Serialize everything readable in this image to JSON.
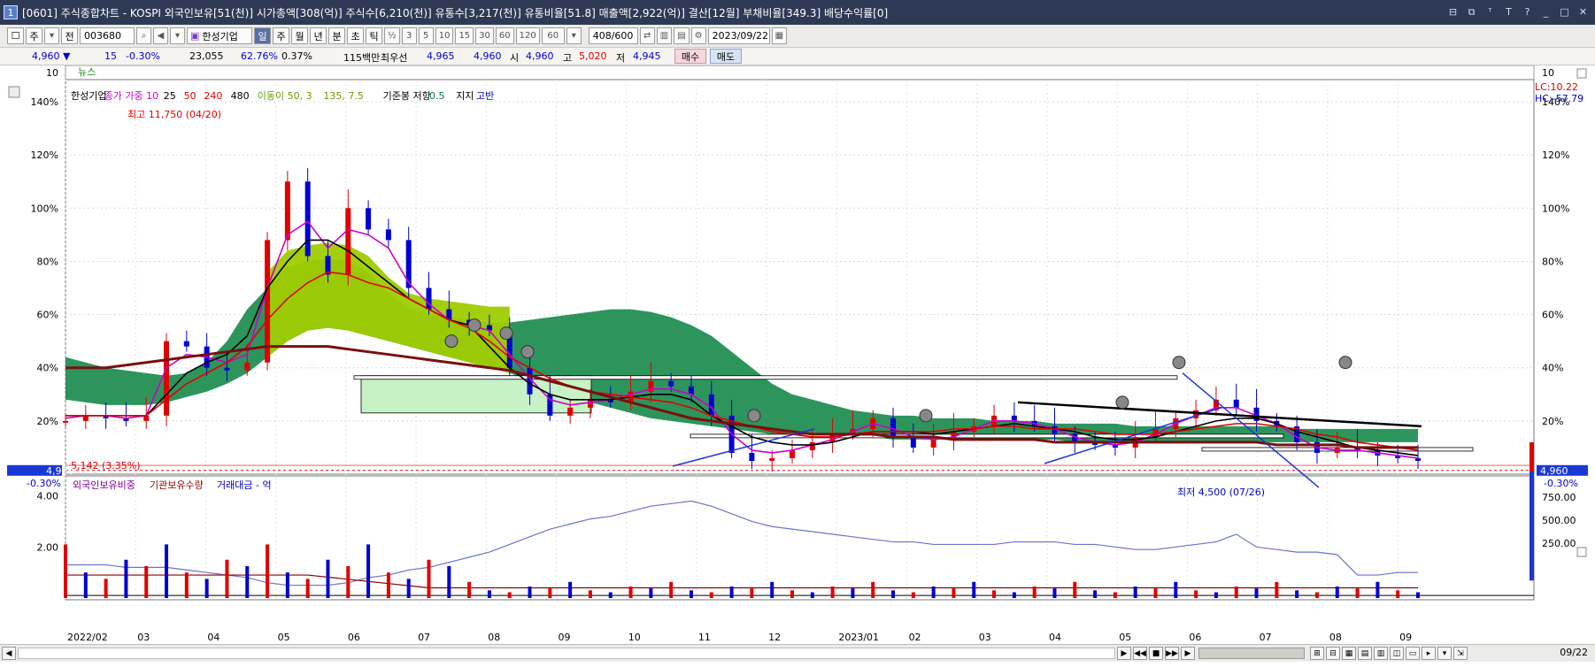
{
  "titlebar": {
    "num": "1",
    "text": "[0601] 주식종합차트 - KOSPI 외국인보유[51(천)] 시가총액[308(억)] 주식수[6,210(천)] 유통수[3,217(천)] 유통비율[51.8] 매출액[2,922(억)] 결산[12월] 부채비율[349.3] 배당수익률[0]",
    "icons": [
      "restore-icon",
      "window-icon",
      "font-icon",
      "text-icon",
      "help-icon",
      "minimize-icon",
      "maximize-icon",
      "close-icon"
    ],
    "icon_glyphs": [
      "⊟",
      "⧉",
      "ᵀ",
      "T",
      "?",
      "_",
      "□",
      "✕"
    ]
  },
  "toolbar": {
    "market": "주",
    "mode": "전",
    "code": "003680",
    "name": "한성기업",
    "periods": [
      "일",
      "주",
      "월",
      "년",
      "분",
      "초",
      "틱"
    ],
    "active_period": "일",
    "ticks": [
      "½",
      "3",
      "5",
      "10",
      "15",
      "30",
      "60",
      "120",
      "60"
    ],
    "count": "408/600",
    "date": "2023/09/22"
  },
  "quote": {
    "price": "4,960",
    "arrow": "▼",
    "change": "15",
    "change_pct": "-0.30%",
    "volume": "23,055",
    "vol_ratio": "62.76%",
    "turnover": "0.37%",
    "amount": "115백만",
    "best_ask_label": "최우선",
    "best_ask": "4,965",
    "best_bid": "4,960",
    "open_label": "시",
    "open": "4,960",
    "high_label": "고",
    "high": "5,020",
    "low_label": "저",
    "low": "4,945",
    "buy": "매수",
    "sell": "매도"
  },
  "chart_data": [
    {
      "type": "line",
      "title": "",
      "legend": [
        "한성기업",
        "종가 가중 10",
        "25",
        "50",
        "240",
        "480",
        "이동이 50, 3",
        "135, 7.5",
        "기준봉 저항",
        "0.5",
        "지지",
        "고반"
      ],
      "legend_colors": [
        "#000",
        "#cc00cc",
        "#000",
        "#e00000",
        "#e00000",
        "#000",
        "#6a9c00",
        "#6a9c00",
        "#000",
        "#007a3d",
        "#000",
        "#0000d0"
      ],
      "ylabel": "%",
      "y_ticks": [
        "140%",
        "120%",
        "100%",
        "80%",
        "60%",
        "40%",
        "20%"
      ],
      "ylim": [
        0,
        145
      ],
      "x_ticks": [
        "2022/02",
        "03",
        "04",
        "05",
        "06",
        "07",
        "08",
        "09",
        "10",
        "11",
        "12",
        "2023/01",
        "02",
        "03",
        "04",
        "05",
        "06",
        "07",
        "08",
        "09"
      ],
      "x_end_label": "09/22",
      "series": [
        {
          "values": [
            20,
            22,
            21,
            20,
            22,
            50,
            48,
            40,
            39,
            42,
            88,
            110,
            82,
            75,
            100,
            92,
            88,
            70,
            62,
            58,
            56,
            54,
            40,
            30,
            22,
            25,
            28,
            27,
            31,
            35,
            33,
            30,
            22,
            8,
            5,
            6,
            9,
            12,
            15,
            17,
            21,
            14,
            10,
            13,
            16,
            18,
            22,
            20,
            18,
            15,
            12,
            11,
            10,
            14,
            17,
            21,
            24,
            28,
            25,
            20,
            18,
            12,
            8,
            10,
            9,
            7,
            6,
            5
          ]
        },
        {
          "name": "10",
          "values": [
            21,
            22,
            22,
            21,
            22,
            40,
            45,
            44,
            42,
            45,
            70,
            90,
            95,
            85,
            92,
            90,
            85,
            72,
            64,
            58,
            56,
            54,
            45,
            36,
            28,
            26,
            27,
            28,
            30,
            32,
            32,
            30,
            25,
            15,
            9,
            8,
            9,
            11,
            13,
            16,
            19,
            17,
            14,
            13,
            14,
            17,
            20,
            20,
            19,
            17,
            14,
            12,
            11,
            12,
            15,
            19,
            22,
            25,
            25,
            22,
            19,
            14,
            10,
            9,
            9,
            8,
            7,
            6
          ]
        },
        {
          "name": "25",
          "values": [
            22,
            22,
            22,
            22,
            22,
            30,
            38,
            42,
            45,
            52,
            70,
            80,
            88,
            88,
            84,
            78,
            72,
            66,
            62,
            58,
            56,
            48,
            40,
            34,
            30,
            28,
            28,
            28,
            29,
            30,
            30,
            28,
            22,
            18,
            14,
            12,
            11,
            11,
            12,
            14,
            16,
            16,
            16,
            15,
            16,
            17,
            18,
            19,
            18,
            17,
            16,
            14,
            13,
            13,
            14,
            16,
            18,
            20,
            21,
            21,
            19,
            16,
            14,
            12,
            10,
            9,
            8,
            7
          ]
        },
        {
          "name": "50",
          "values": [
            22,
            22,
            22,
            22,
            22,
            28,
            34,
            38,
            42,
            48,
            58,
            66,
            72,
            76,
            75,
            72,
            70,
            66,
            62,
            58,
            55,
            50,
            44,
            40,
            36,
            33,
            31,
            30,
            29,
            28,
            27,
            25,
            22,
            20,
            18,
            16,
            15,
            14,
            14,
            15,
            16,
            16,
            16,
            16,
            17,
            17,
            18,
            18,
            17,
            17,
            17,
            16,
            15,
            15,
            15,
            16,
            17,
            18,
            19,
            19,
            18,
            17,
            15,
            14,
            12,
            11,
            10,
            9
          ]
        },
        {
          "name": "240",
          "values": [
            40,
            40,
            40,
            41,
            42,
            43,
            44,
            45,
            46,
            47,
            48,
            48,
            48,
            48,
            47,
            46,
            45,
            44,
            43,
            42,
            41,
            40,
            39,
            37,
            35,
            33,
            31,
            29,
            27,
            25,
            23,
            21,
            20,
            19,
            18,
            17,
            16,
            15,
            15,
            15,
            15,
            14,
            14,
            14,
            13,
            13,
            13,
            13,
            13,
            12,
            12,
            12,
            12,
            12,
            12,
            12,
            12,
            12,
            12,
            12,
            11,
            11,
            11,
            11,
            10,
            10,
            10,
            10
          ]
        }
      ]
    },
    {
      "type": "line",
      "title": "",
      "legend": [
        "외국인보유비중",
        "기관보유수량",
        "거래대금 - 억"
      ],
      "legend_colors": [
        "#7a00a0",
        "#8b0000",
        "#0000cc"
      ],
      "left_ticks": [
        "4.00",
        "2.00"
      ],
      "right_ticks": [
        "750.00",
        "500.00",
        "250.00"
      ],
      "series": [
        {
          "name": "외국인보유비중",
          "values": [
            1.3,
            1.3,
            1.3,
            1.2,
            1.2,
            1.2,
            1.1,
            1.0,
            0.9,
            0.8,
            0.6,
            0.5,
            0.5,
            0.5,
            0.6,
            0.8,
            0.9,
            1.1,
            1.2,
            1.4,
            1.6,
            1.8,
            2.1,
            2.4,
            2.7,
            2.9,
            3.1,
            3.2,
            3.4,
            3.6,
            3.7,
            3.8,
            3.6,
            3.3,
            3.0,
            2.8,
            2.7,
            2.6,
            2.5,
            2.4,
            2.3,
            2.2,
            2.2,
            2.1,
            2.1,
            2.1,
            2.1,
            2.2,
            2.2,
            2.2,
            2.1,
            2.1,
            2.0,
            1.9,
            1.9,
            2.0,
            2.1,
            2.2,
            2.5,
            2.0,
            1.9,
            1.8,
            1.8,
            1.7,
            0.9,
            0.9,
            1.0,
            1.0
          ]
        }
      ]
    }
  ],
  "annotations": {
    "high": "최고 11,750 (04/20)",
    "low": "최저 4,500 (07/26)",
    "ref": "5,142 (3.35%)",
    "price_tag": "4,960",
    "price_pct": "-0.30%",
    "lc": "LC:10.22",
    "hc": "HC:-57.79",
    "news": "뉴스",
    "news_tick": "10"
  },
  "colors": {
    "up": "#e00000",
    "down": "#0000d0",
    "cloud_light": "#9fcc00",
    "cloud_dark": "#168a4a",
    "box_fill": "#c6f2c6"
  }
}
